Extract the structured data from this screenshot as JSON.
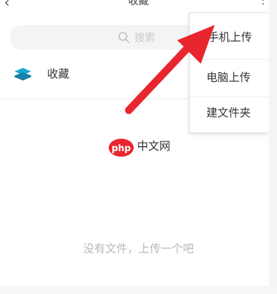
{
  "nav": {
    "title": "收藏"
  },
  "search": {
    "placeholder": "搜索"
  },
  "favorites": {
    "label": "收藏"
  },
  "watermark": {
    "logo": "php",
    "text": "中文网"
  },
  "empty_state": {
    "text": "没有文件，上传一个吧"
  },
  "menu": {
    "items": [
      {
        "label": "手机上传"
      },
      {
        "label": "电脑上传"
      },
      {
        "label": "建文件夹"
      }
    ]
  },
  "colors": {
    "arrow": "#e8262e",
    "watermark_logo": "#e8262e",
    "favorites_icon": "#1aa6d6",
    "search_bg": "#f3f4f6"
  },
  "icons": {
    "back": "chevron-left-icon",
    "more": "more-icon",
    "search": "search-icon",
    "favorites": "stack-icon"
  }
}
